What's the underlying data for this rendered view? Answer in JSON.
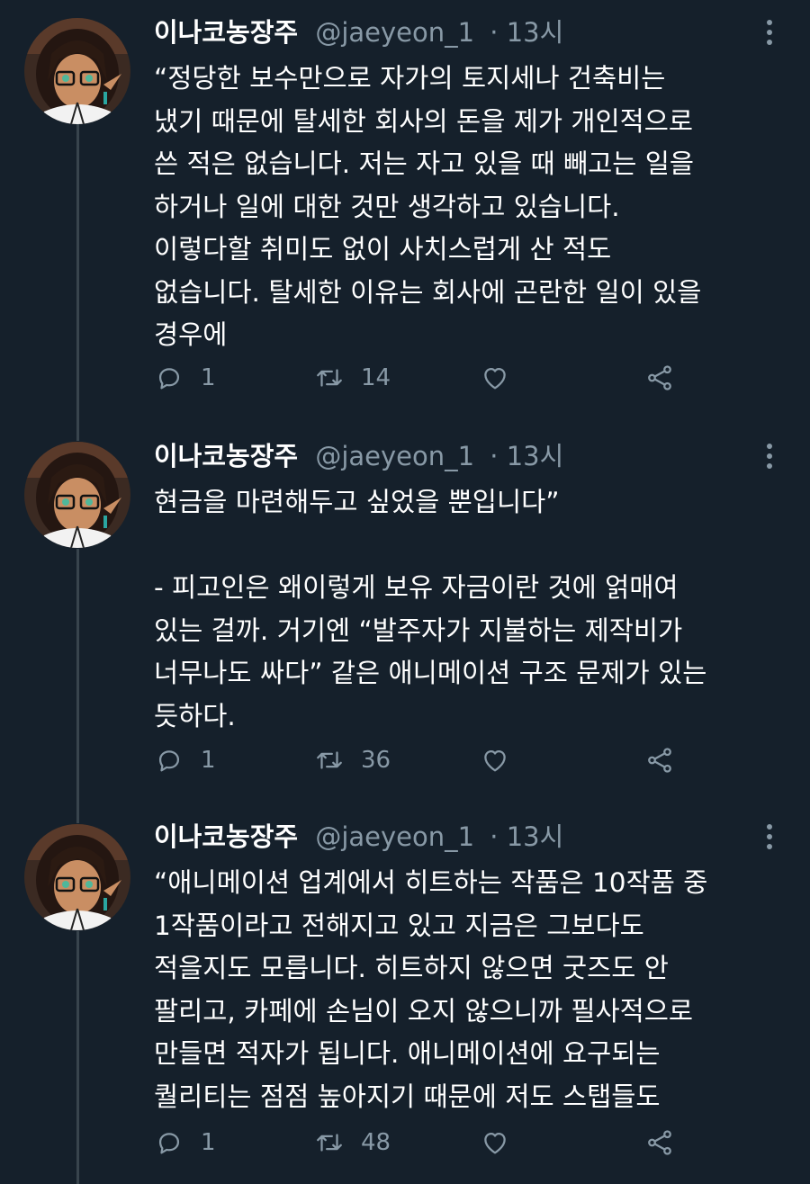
{
  "tweets": [
    {
      "author_name": "이나코농장주",
      "author_handle": "@jaeyeon_1",
      "meta_time": "· 13시",
      "lines": [
        "“정당한 보수만으로 자가의 토지세나 건축비는",
        "냈기 때문에 탈세한 회사의 돈을 제가 개인적으로",
        "쓴 적은 없습니다. 저는 자고 있을 때 빼고는 일을",
        "하거나 일에 대한 것만 생각하고 있습니다.",
        "이렇다할 취미도 없이 사치스럽게 산 적도",
        "없습니다. 탈세한 이유는 회사에 곤란한 일이 있을",
        "경우에"
      ],
      "reply_count": "1",
      "retweet_count": "14"
    },
    {
      "author_name": "이나코농장주",
      "author_handle": "@jaeyeon_1",
      "meta_time": "· 13시",
      "lines": [
        "현금을 마련해두고 싶었을 뿐입니다”",
        "",
        "- 피고인은 왜이렇게 보유 자금이란 것에 얽매여",
        "있는 걸까. 거기엔 “발주자가 지불하는 제작비가",
        "너무나도 싸다” 같은 애니메이션 구조 문제가 있는",
        "듯하다."
      ],
      "reply_count": "1",
      "retweet_count": "36"
    },
    {
      "author_name": "이나코농장주",
      "author_handle": "@jaeyeon_1",
      "meta_time": "· 13시",
      "lines": [
        "“애니메이션 업계에서 히트하는 작품은 10작품 중",
        "1작품이라고 전해지고 있고 지금은 그보다도",
        "적을지도 모릅니다. 히트하지 않으면 굿즈도 안",
        "팔리고, 카페에 손님이 오지 않으니까 필사적으로",
        "만들면 적자가 됩니다. 애니메이션에 요구되는",
        "퀄리티는 점점 높아지기 때문에 저도 스탭들도"
      ],
      "reply_count": "1",
      "retweet_count": "48"
    }
  ],
  "icons": {
    "reply": "reply-icon",
    "retweet": "retweet-icon",
    "like": "heart-icon",
    "share": "share-icon",
    "more": "more-options-icon"
  },
  "colors": {
    "background": "#15202b",
    "text": "#ffffff",
    "secondary": "#8899a6",
    "thread_line": "#38444d"
  }
}
